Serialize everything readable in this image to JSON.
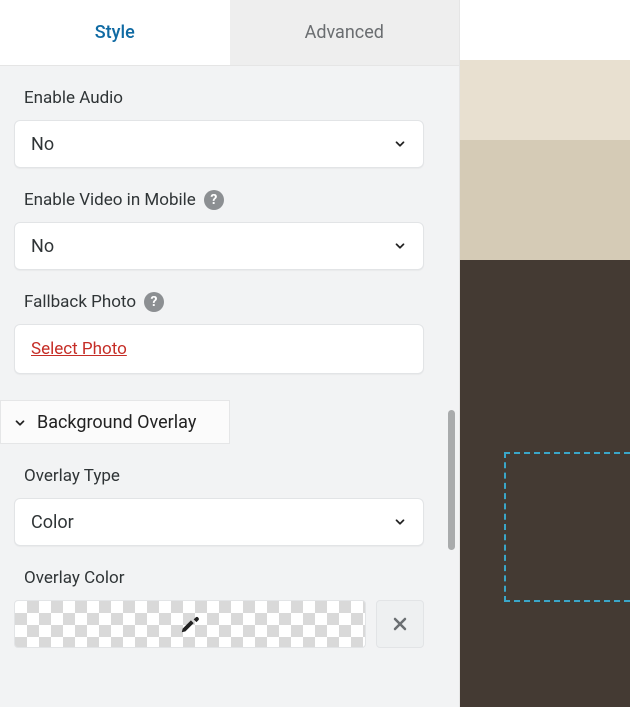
{
  "tabs": {
    "style": "Style",
    "advanced": "Advanced"
  },
  "fields": {
    "enable_audio": {
      "label": "Enable Audio",
      "value": "No"
    },
    "enable_video_mobile": {
      "label": "Enable Video in Mobile",
      "value": "No"
    },
    "fallback_photo": {
      "label": "Fallback Photo",
      "action": "Select Photo"
    },
    "overlay_type": {
      "label": "Overlay Type",
      "value": "Color"
    },
    "overlay_color": {
      "label": "Overlay Color"
    }
  },
  "sections": {
    "background_overlay": "Background Overlay"
  }
}
